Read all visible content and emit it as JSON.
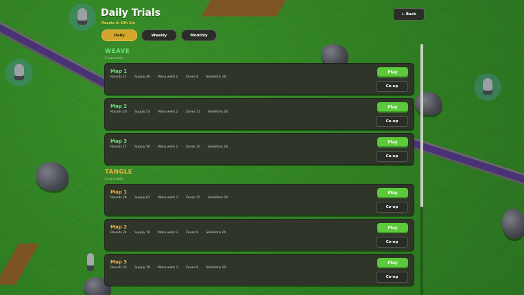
{
  "header": {
    "title": "Daily Trials",
    "subtitle": "Resets in 19h 2m",
    "back_label": "← Back"
  },
  "tabs": [
    {
      "label": "Daily",
      "active": true
    },
    {
      "label": "Weekly",
      "active": false
    },
    {
      "label": "Monthly",
      "active": false
    }
  ],
  "colors": {
    "weave_accent": "#6fe07a",
    "tangle_accent": "#f0b445",
    "play_button": "#5bc93a",
    "active_tab": "#d4a52c"
  },
  "sections": [
    {
      "name": "WEAVE",
      "subtitle": "2 mana wells",
      "maps": [
        {
          "name": "Map 1",
          "stats": [
            "Rounds 17",
            "Supply 40",
            "Mana wells 2",
            "Zones 8",
            "Skeletons 16"
          ],
          "play": "Play",
          "coop": "Co-op"
        },
        {
          "name": "Map 2",
          "stats": [
            "Rounds 20",
            "Supply 53",
            "Mana wells 2",
            "Zones 11",
            "Skeletons 16"
          ],
          "play": "Play",
          "coop": "Co-op"
        },
        {
          "name": "Map 3",
          "stats": [
            "Rounds 17",
            "Supply 50",
            "Mana wells 2",
            "Zones 10",
            "Skeletons 16"
          ],
          "play": "Play",
          "coop": "Co-op"
        }
      ]
    },
    {
      "name": "TANGLE",
      "subtitle": "3 mana wells",
      "maps": [
        {
          "name": "Map 1",
          "stats": [
            "Rounds 26",
            "Supply 62",
            "Mana wells 3",
            "Zones 15",
            "Skeletons 20"
          ],
          "play": "Play",
          "coop": "Co-op"
        },
        {
          "name": "Map 2",
          "stats": [
            "Rounds 24",
            "Supply 70",
            "Mana wells 3",
            "Zones 9",
            "Skeletons 20"
          ],
          "play": "Play",
          "coop": "Co-op"
        },
        {
          "name": "Map 3",
          "stats": [
            "Rounds 26",
            "Supply 78",
            "Mana wells 3",
            "Zones 8",
            "Skeletons 20"
          ],
          "play": "Play",
          "coop": "Co-op"
        }
      ]
    }
  ]
}
